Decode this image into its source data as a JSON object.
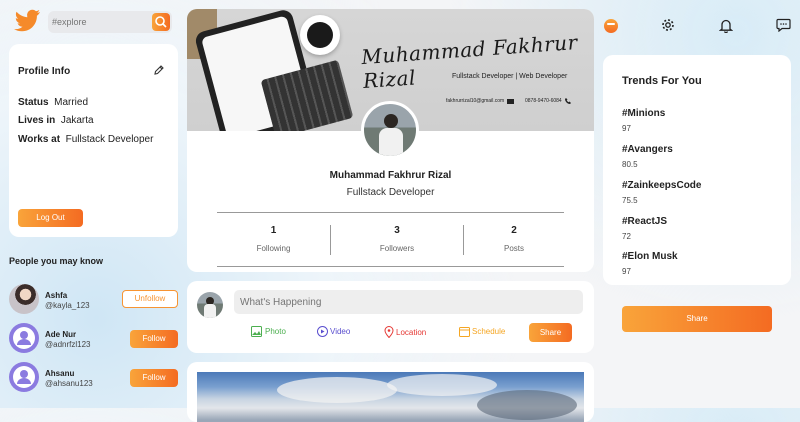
{
  "search": {
    "placeholder": "#explore"
  },
  "profile_info": {
    "title": "Profile Info",
    "status_label": "Status",
    "status_value": "Married",
    "lives_label": "Lives in",
    "lives_value": "Jakarta",
    "works_label": "Works at",
    "works_value": "Fullstack Developer",
    "logout_label": "Log Out"
  },
  "suggestions": {
    "title": "People you may know",
    "people": [
      {
        "name": "Ashfa",
        "handle": "@kayla_123",
        "action": "Unfollow"
      },
      {
        "name": "Ade Nur",
        "handle": "@adnrfzl123",
        "action": "Follow"
      },
      {
        "name": "Ahsanu",
        "handle": "@ahsanu123",
        "action": "Follow"
      }
    ]
  },
  "cover": {
    "signature": "Muhammad Fakhrur Rizal",
    "subtitle": "Fullstack Developer | Web Developer",
    "email": "fakhrurrizal10@gmail.com",
    "phone": "0878-9470-6084"
  },
  "profile": {
    "name": "Muhammad Fakhrur Rizal",
    "role": "Fullstack Developer",
    "stats": [
      {
        "value": "1",
        "label": "Following"
      },
      {
        "value": "3",
        "label": "Followers"
      },
      {
        "value": "2",
        "label": "Posts"
      }
    ]
  },
  "composer": {
    "placeholder": "What's Happening",
    "photo": "Photo",
    "video": "Video",
    "location": "Location",
    "schedule": "Schedule",
    "share": "Share"
  },
  "trends": {
    "title": "Trends For You",
    "items": [
      {
        "tag": "#Minions",
        "count": "97"
      },
      {
        "tag": "#Avangers",
        "count": "80.5"
      },
      {
        "tag": "#ZainkeepsCode",
        "count": "75.5"
      },
      {
        "tag": "#ReactJS",
        "count": "72"
      },
      {
        "tag": "#Elon Musk",
        "count": "97"
      }
    ],
    "share": "Share"
  },
  "colors": {
    "accent": "#f79432",
    "accent_dark": "#f46b22",
    "photo": "#4caf50",
    "video": "#5a4fcf",
    "location": "#e53935",
    "schedule": "#f5a623"
  },
  "icons": [
    "bird-logo-icon",
    "search-icon",
    "edit-icon",
    "home-icon",
    "gear-icon",
    "bell-icon",
    "chat-icon"
  ]
}
